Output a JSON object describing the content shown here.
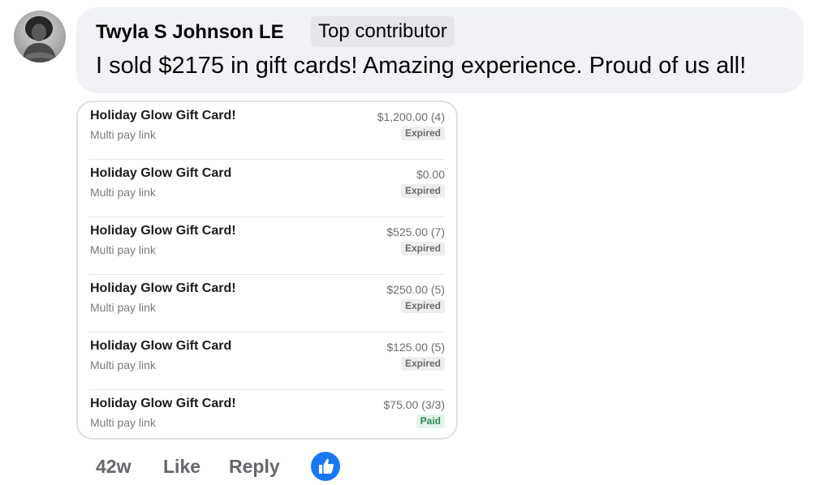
{
  "comment": {
    "author": "Twyla S Johnson LE",
    "badge": "Top contributor",
    "text": "I sold $2175 in gift cards! Amazing experience. Proud of us all!",
    "time": "42w",
    "like_label": "Like",
    "reply_label": "Reply",
    "reaction_icon": "thumbs-up-icon",
    "reaction_color": "#1877f2"
  },
  "attachment": {
    "rows": [
      {
        "title": "Holiday Glow Gift Card!",
        "subtitle": "Multi pay link",
        "amount": "$1,200.00 (4)",
        "status": "Expired"
      },
      {
        "title": "Holiday Glow Gift Card",
        "subtitle": "Multi pay link",
        "amount": "$0.00",
        "status": "Expired"
      },
      {
        "title": "Holiday Glow Gift Card!",
        "subtitle": "Multi pay link",
        "amount": "$525.00 (7)",
        "status": "Expired"
      },
      {
        "title": "Holiday Glow Gift Card!",
        "subtitle": "Multi pay link",
        "amount": "$250.00 (5)",
        "status": "Expired"
      },
      {
        "title": "Holiday Glow Gift Card",
        "subtitle": "Multi pay link",
        "amount": "$125.00 (5)",
        "status": "Expired"
      },
      {
        "title": "Holiday Glow Gift Card!",
        "subtitle": "Multi pay link",
        "amount": "$75.00 (3/3)",
        "status": "Paid"
      }
    ]
  }
}
